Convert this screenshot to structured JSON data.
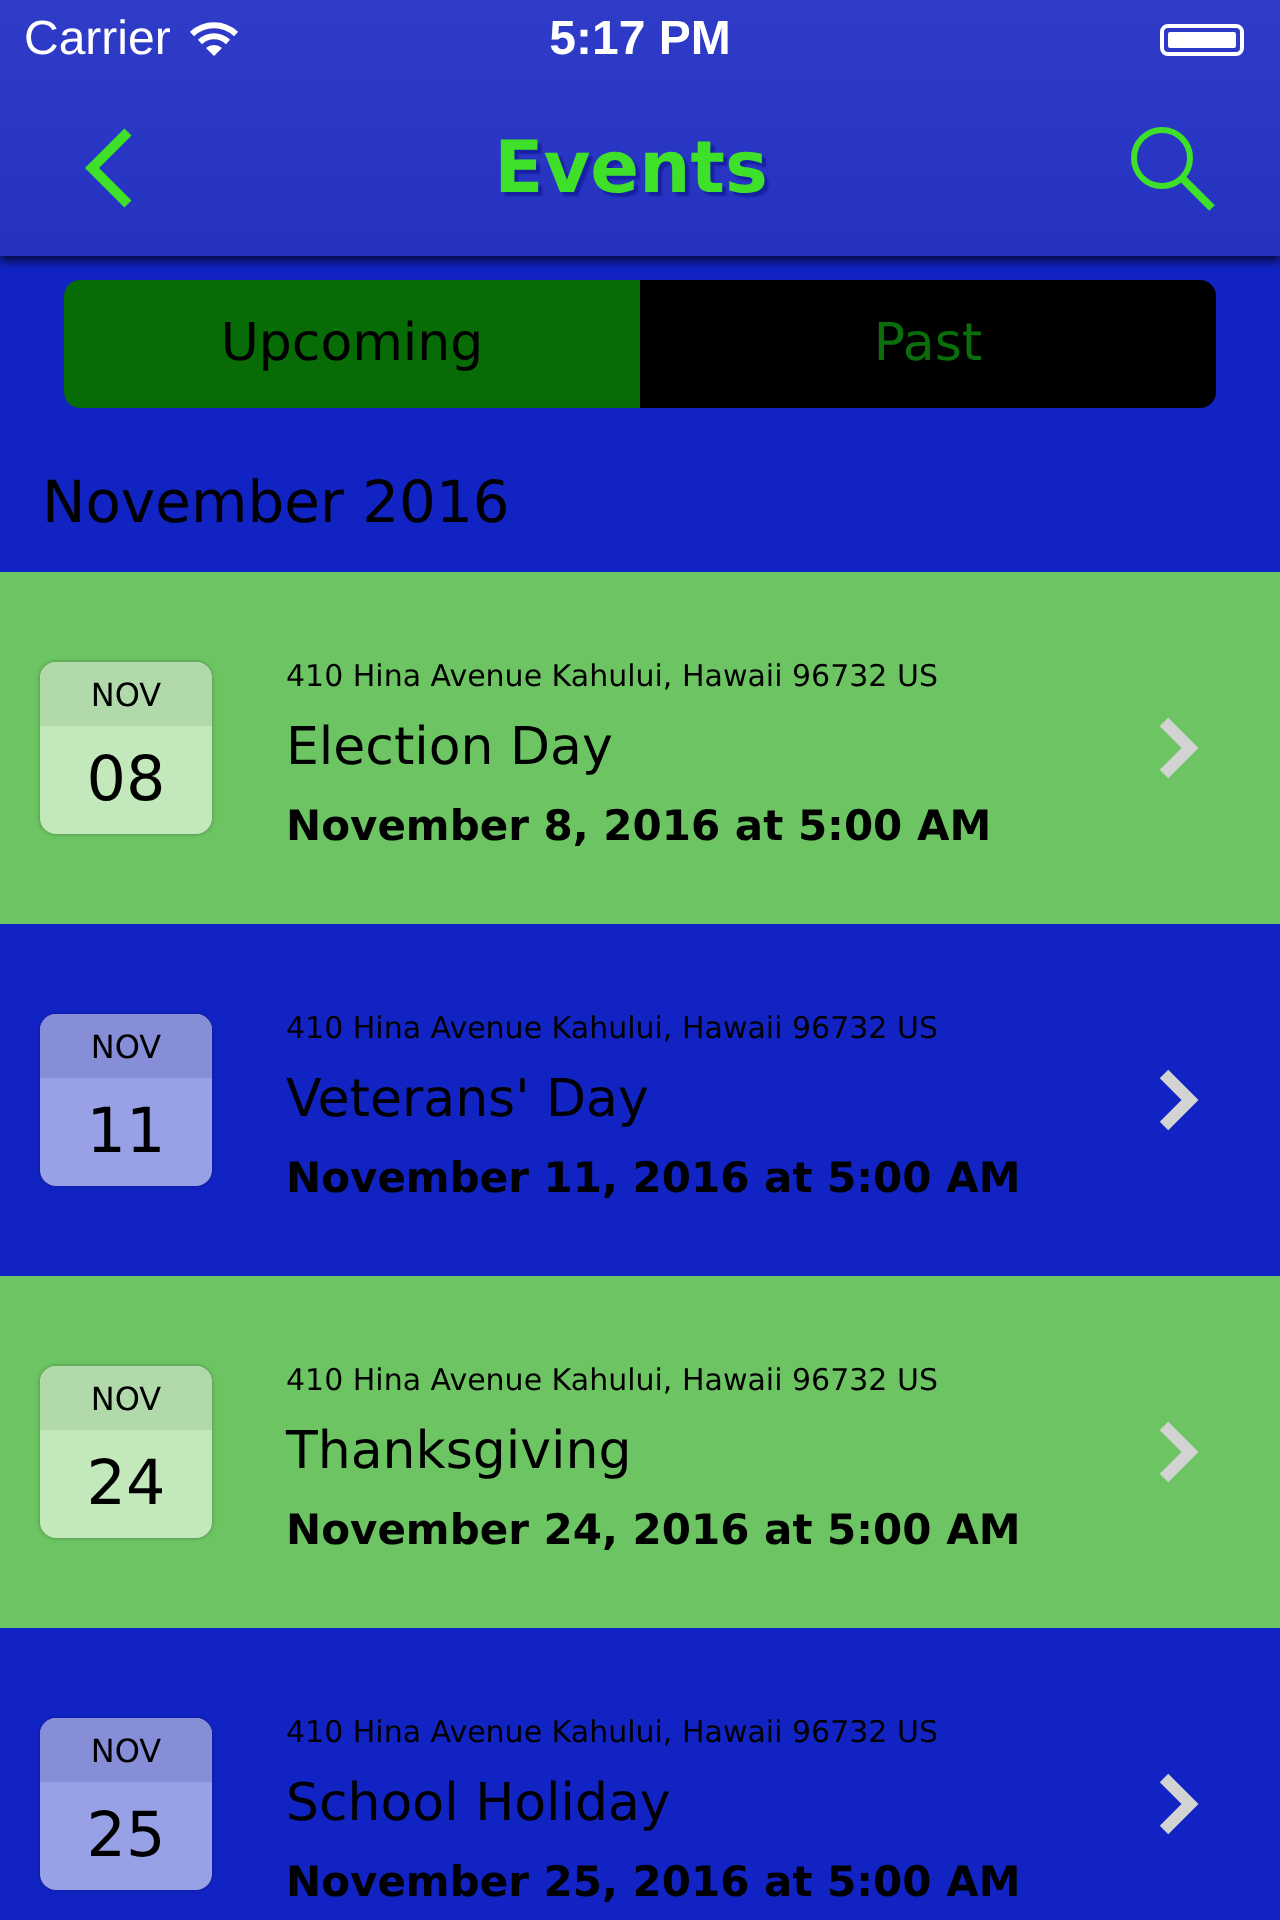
{
  "status_bar": {
    "carrier": "Carrier",
    "time": "5:17 PM"
  },
  "nav": {
    "title": "Events"
  },
  "segments": [
    {
      "label": "Upcoming",
      "selected": true
    },
    {
      "label": "Past",
      "selected": false
    }
  ],
  "section": {
    "title": "November 2016"
  },
  "events": [
    {
      "month": "NOV",
      "day": "08",
      "address": "410 Hina Avenue Kahului, Hawaii 96732 US",
      "title": "Election Day",
      "datetime": "November 8, 2016 at 5:00 AM"
    },
    {
      "month": "NOV",
      "day": "11",
      "address": "410 Hina Avenue Kahului, Hawaii 96732 US",
      "title": "Veterans' Day",
      "datetime": "November 11, 2016 at 5:00 AM"
    },
    {
      "month": "NOV",
      "day": "24",
      "address": "410 Hina Avenue Kahului, Hawaii 96732 US",
      "title": "Thanksgiving",
      "datetime": "November 24, 2016 at 5:00 AM"
    },
    {
      "month": "NOV",
      "day": "25",
      "address": "410 Hina Avenue Kahului, Hawaii 96732 US",
      "title": "School Holiday",
      "datetime": "November 25, 2016 at 5:00 AM"
    }
  ]
}
